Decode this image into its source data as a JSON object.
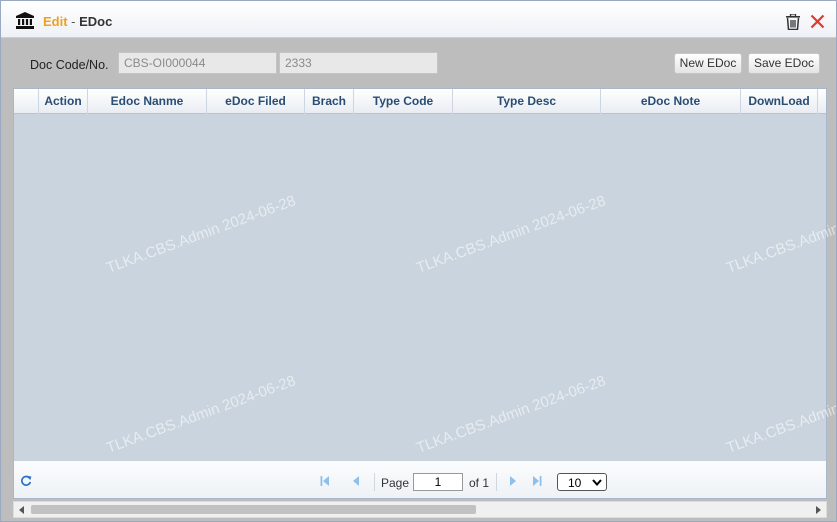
{
  "window": {
    "title_edit": "Edit",
    "title_sep": " - ",
    "title_name": "EDoc"
  },
  "toolbar": {
    "doc_label": "Doc Code/No.",
    "doc_code_value": "CBS-OI000044",
    "doc_no_value": "2333",
    "new_label": "New EDoc",
    "save_label": "Save EDoc"
  },
  "grid": {
    "columns": [
      "Action",
      "Edoc Nanme",
      "eDoc Filed",
      "Brach",
      "Type Code",
      "Type Desc",
      "eDoc Note",
      "DownLoad"
    ]
  },
  "pager": {
    "page_label": "Page",
    "page_value": "1",
    "of_label": "of 1",
    "page_size": "10"
  },
  "watermark": "TLKA.CBS.Admin 2024-06-28",
  "icons": {
    "title": "bank-icon",
    "trash": "trash-icon",
    "close": "close-icon",
    "refresh": "refresh-icon"
  },
  "colors": {
    "accent_edit": "#f0a020",
    "header_text": "#2a4d74",
    "close": "#e03a2e",
    "pager_icon": "#5aa0e0"
  }
}
